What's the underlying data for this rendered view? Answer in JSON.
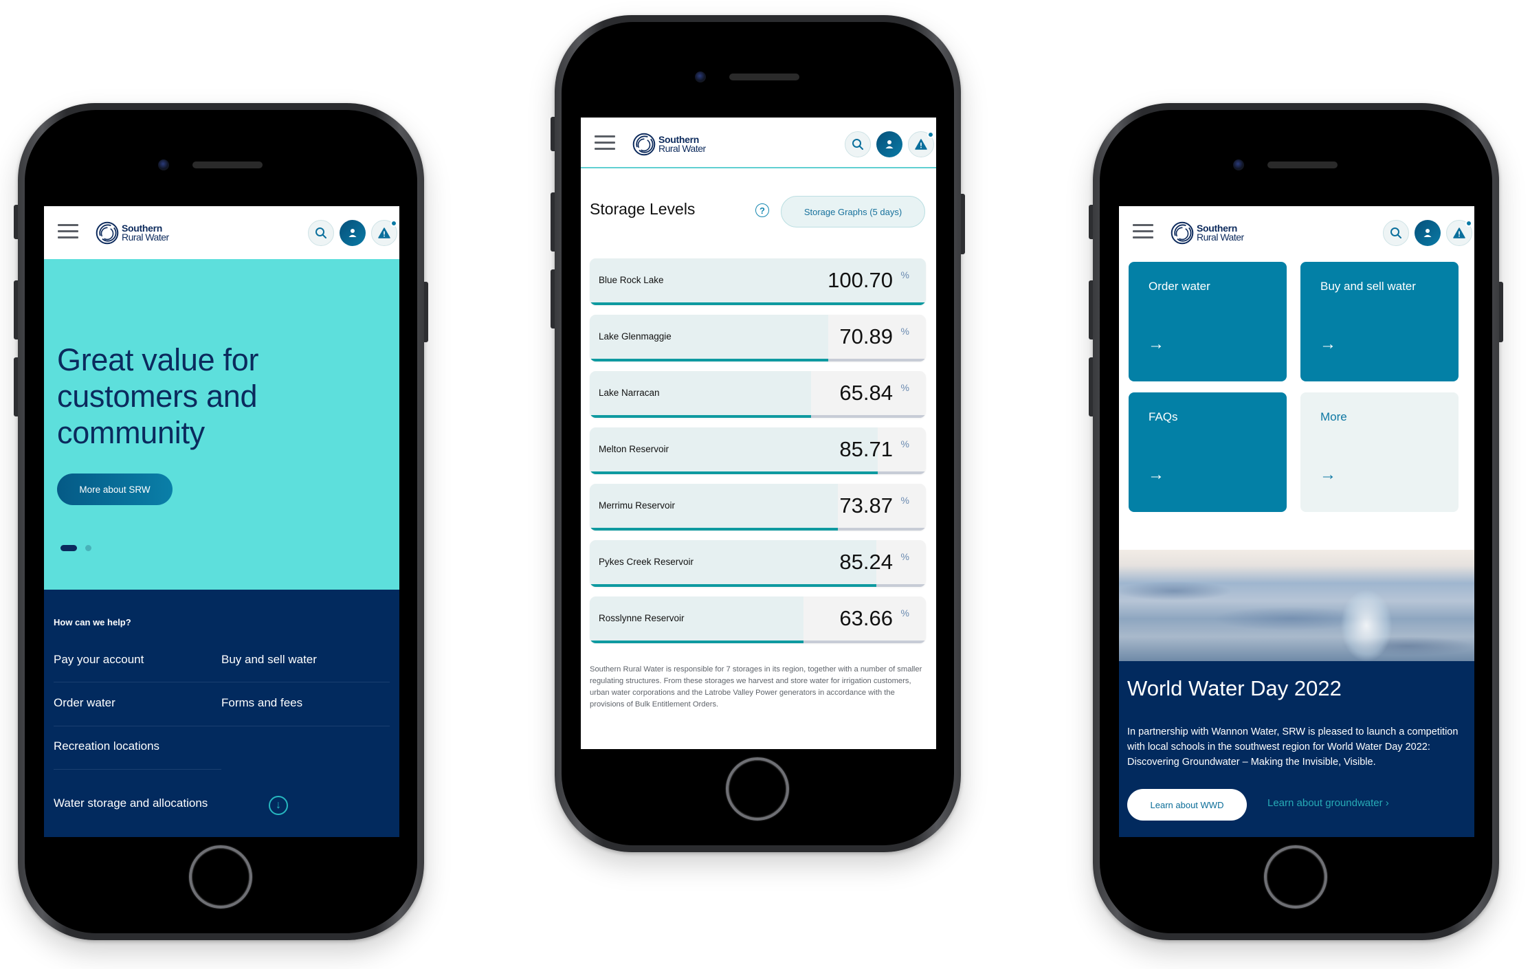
{
  "brand": {
    "name_line1": "Southern",
    "name_line2": "Rural Water",
    "colors": {
      "navy": "#022a5e",
      "teal_hero": "#5ddfdc",
      "accent_blue": "#0380a6",
      "bar_fill": "#0e9aa0"
    }
  },
  "header": {
    "menu_icon": "hamburger-icon",
    "search_icon": "search-icon",
    "account_icon": "user-icon",
    "alert_icon": "warning-icon"
  },
  "home_screen": {
    "hero": {
      "title": "Great value for customers and community",
      "cta_label": "More about SRW",
      "carousel": {
        "total": 2,
        "active": 1
      }
    },
    "help": {
      "title": "How can we help?",
      "links": [
        "Pay your account",
        "Buy and sell water",
        "Order water",
        "Forms and fees",
        "Recreation locations"
      ],
      "expand_label": "Water storage and allocations",
      "expand_icon": "arrow-down-circle-icon"
    }
  },
  "storage_screen": {
    "title": "Storage Levels",
    "help_icon": "question-circle-icon",
    "graphs_button": "Storage Graphs (5 days)",
    "unit": "%",
    "storages": [
      {
        "name": "Blue Rock Lake",
        "value": "100.70",
        "level_percent": 100.7
      },
      {
        "name": "Lake Glenmaggie",
        "value": "70.89",
        "level_percent": 70.89
      },
      {
        "name": "Lake Narracan",
        "value": "65.84",
        "level_percent": 65.84
      },
      {
        "name": "Melton Reservoir",
        "value": "85.71",
        "level_percent": 85.71
      },
      {
        "name": "Merrimu Reservoir",
        "value": "73.87",
        "level_percent": 73.87
      },
      {
        "name": "Pykes Creek Reservoir",
        "value": "85.24",
        "level_percent": 85.24
      },
      {
        "name": "Rosslynne Reservoir",
        "value": "63.66",
        "level_percent": 63.66
      }
    ],
    "description": "Southern Rural Water is responsible for 7 storages in its region, together with a number of smaller regulating structures. From these storages we harvest and store water for irrigation customers, urban water corporations and the Latrobe Valley Power generators in accordance with the provisions of Bulk Entitlement Orders."
  },
  "services_screen": {
    "tiles": [
      {
        "label": "Order water",
        "arrow": "→"
      },
      {
        "label": "Buy and sell water",
        "arrow": "→"
      },
      {
        "label": "FAQs",
        "arrow": "→"
      },
      {
        "label": "More",
        "arrow": "→"
      }
    ],
    "feature": {
      "image_alt": "water-splash-image",
      "title": "World Water Day 2022",
      "body": "In partnership with Wannon Water, SRW is pleased to launch a competition with local schools in the southwest region for World Water Day 2022: Discovering Groundwater – Making the Invisible, Visible.",
      "primary_button": "Learn about WWD",
      "secondary_link": "Learn about groundwater ›"
    }
  }
}
